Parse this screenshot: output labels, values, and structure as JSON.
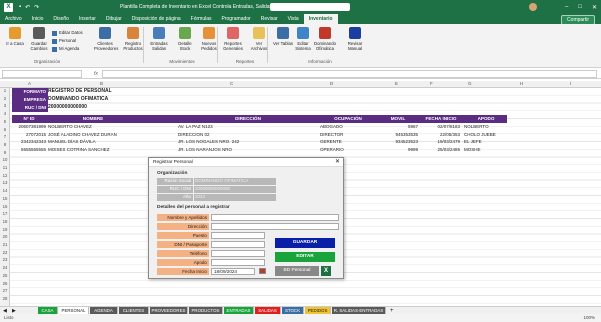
{
  "titlebar": {
    "app_icon": "excel-logo",
    "title": "Plantilla Completa de Inventario en Excel Controla Entradas, Salidas y Stock Facilmente - ..."
  },
  "menu": {
    "tabs": [
      "Archivo",
      "Inicio",
      "Diseño",
      "Insertar",
      "Dibujar",
      "Disposición de página",
      "Fórmulas",
      "Programador",
      "Revisar",
      "Vista",
      "Inventario"
    ],
    "active": "Inventario",
    "share": "Compartir"
  },
  "ribbon": {
    "buttons": [
      {
        "label": "Ir a Casa",
        "icon": "home-icon",
        "color": "#e69b2e"
      },
      {
        "label": "Guardar Cambios",
        "icon": "save-icon",
        "color": "#5a5a5a"
      },
      {
        "label": "Clientes Proveedores",
        "icon": "people-icon",
        "color": "#3a6ea5"
      },
      {
        "label": "Registro Productos",
        "icon": "box-icon",
        "color": "#d9843b"
      },
      {
        "label": "Entradas Salidas",
        "icon": "transfer-icon",
        "color": "#4a7ebb"
      },
      {
        "label": "Detalle Stock",
        "icon": "stock-icon",
        "color": "#6aa84f"
      },
      {
        "label": "Nuevos Pedidos",
        "icon": "order-icon",
        "color": "#e69138"
      },
      {
        "label": "Reportes Generales",
        "icon": "report-icon",
        "color": "#e06666"
      },
      {
        "label": "Ver Archivos",
        "icon": "folder-icon",
        "color": "#e8c15a"
      },
      {
        "label": "Ver Tablas",
        "icon": "table-icon",
        "color": "#3a6ea5"
      },
      {
        "label": "Editar Sistema",
        "icon": "edit-icon",
        "color": "#3d85c6"
      },
      {
        "label": "Dominando Ofimática",
        "icon": "globe-icon",
        "color": "#c0392b"
      },
      {
        "label": "Revisar Manual",
        "icon": "help-icon",
        "color": "#1a3fa0"
      }
    ],
    "small_items": [
      "Editar Datos",
      "Personal",
      "Mi Agenda"
    ],
    "groups": [
      "Organización",
      "Movimientos",
      "Reportes",
      "Información"
    ]
  },
  "grid": {
    "columns": [
      "A",
      "B",
      "C",
      "D",
      "E",
      "F",
      "G",
      "H",
      "I"
    ],
    "rows": [
      "1",
      "2",
      "3",
      "4",
      "5",
      "6",
      "7",
      "8",
      "9",
      "10",
      "11",
      "12",
      "13",
      "14",
      "15",
      "16",
      "17",
      "18",
      "19",
      "20",
      "21",
      "22",
      "23",
      "24",
      "25",
      "26",
      "27",
      "28"
    ]
  },
  "header_info": {
    "formato_label": "FORMATO",
    "formato_value": "REGISTRO DE PERSONAL",
    "empresa_label": "EMPRESA",
    "empresa_value": "DOMINANDO OFIMATICA",
    "ruc_label": "RUC / DNI",
    "ruc_value": "20000000000000"
  },
  "table": {
    "headers": [
      "N° ID",
      "NOMBRE",
      "DIRECCIÓN",
      "OCUPACIÓN",
      "MOVIL",
      "FECHA INICIO",
      "APODO"
    ],
    "rows": [
      [
        "20607381999",
        "NOLBERTO CHAVEZ",
        "AV. LA PAZ N123",
        "ABOGADO",
        "5967",
        "02/07/8183",
        "NOLBERTO"
      ],
      [
        "27072015",
        "JOSÉ ALADINO CHAVEZ DURAN",
        "DIRECCION 02",
        "DIRECTOR",
        "945353535",
        "22/05/353",
        "CHOLO JUEBE"
      ],
      [
        "2342342343",
        "MANUEL DÍAS DÁVILA",
        "JR. LOS NOGALES NRO. 242",
        "GERENTE",
        "934523523",
        "19/03/2479",
        "EL JEFE"
      ],
      [
        "5555555555",
        "MOISES COTRINA SANCHEZ",
        "JR. LOS NARANJOS NRO",
        "OPERARIO",
        "9999",
        "25/03/2485",
        "MOSHE"
      ]
    ]
  },
  "dialog": {
    "title": "Registrar Personal",
    "org_section": "Organización",
    "org_fields": [
      {
        "label": "Razón Social",
        "value": "DOMINANDO OFIMATICA"
      },
      {
        "label": "RUC / DNI",
        "value": "20000000000000"
      },
      {
        "label": "Año",
        "value": "2024"
      }
    ],
    "details_section": "Detalles del personal a registrar",
    "fields": [
      {
        "label": "Nombre y Apellidos",
        "value": ""
      },
      {
        "label": "Dirección",
        "value": ""
      },
      {
        "label": "Puesto",
        "value": ""
      },
      {
        "label": "DNI / Pasaporte",
        "value": ""
      },
      {
        "label": "Teléfono",
        "value": ""
      },
      {
        "label": "Apodo",
        "value": ""
      },
      {
        "label": "Fecha Inicio",
        "value": "18/09/2024"
      }
    ],
    "buttons": {
      "guardar": "GUARDAR",
      "editar": "EDITAR",
      "bd": "BD Personal"
    }
  },
  "sheets": [
    {
      "name": "CASA",
      "color": "#19a33b",
      "text": "#fff"
    },
    {
      "name": "PERSONAL",
      "color": "#ffffff",
      "text": "#222"
    },
    {
      "name": "AGENDA",
      "color": "#5a5a5a",
      "text": "#fff"
    },
    {
      "name": "CLIENTES",
      "color": "#5a5a5a",
      "text": "#fff"
    },
    {
      "name": "PROVEEDORES",
      "color": "#5a5a5a",
      "text": "#fff"
    },
    {
      "name": "PRODUCTOS",
      "color": "#5a5a5a",
      "text": "#fff"
    },
    {
      "name": "ENTRADAS",
      "color": "#19a33b",
      "text": "#fff"
    },
    {
      "name": "SALIDAS",
      "color": "#e02020",
      "text": "#fff"
    },
    {
      "name": "STOCK",
      "color": "#3a6ea5",
      "text": "#fff"
    },
    {
      "name": "PEDIDOS",
      "color": "#f1c232",
      "text": "#222"
    },
    {
      "name": "R. SALIDAS-ENTRADAS",
      "color": "#5a5a5a",
      "text": "#fff"
    }
  ],
  "status": {
    "ready": "Listo",
    "zoom": "100%"
  }
}
